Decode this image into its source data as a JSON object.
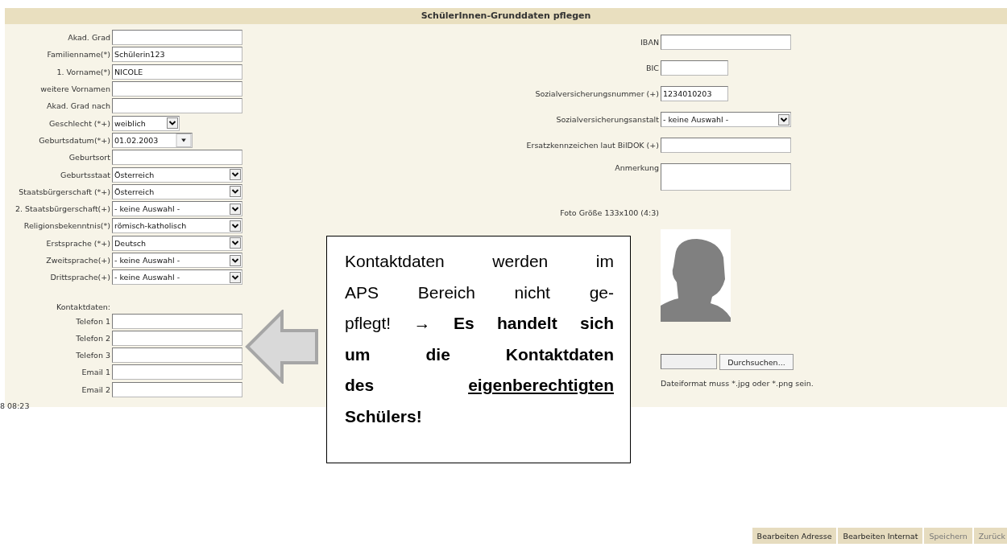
{
  "title": "SchülerInnen-Grunddaten pflegen",
  "person_fields": [
    {
      "label": "Akad. Grad",
      "kind": "text"
    },
    {
      "label": "Familienname(*)",
      "kind": "text",
      "value": "Schülerin123"
    },
    {
      "label": "1. Vorname(*)",
      "kind": "text",
      "value": "NICOLE"
    },
    {
      "label": "weitere Vornamen",
      "kind": "text"
    },
    {
      "label": "Akad. Grad nach",
      "kind": "text"
    },
    {
      "label": "Geschlecht (*+)",
      "kind": "short-select",
      "value": "weiblich"
    },
    {
      "label": "Geburtsdatum(*+)",
      "kind": "date",
      "value": "01.02.2003"
    },
    {
      "label": "Geburtsort",
      "kind": "text"
    },
    {
      "label": "Geburtsstaat",
      "kind": "select",
      "value": "Österreich"
    },
    {
      "label": "Staatsbürgerschaft (*+)",
      "kind": "select",
      "value": "Österreich"
    },
    {
      "label": "2. Staatsbürgerschaft(+)",
      "kind": "select",
      "value": "- keine Auswahl -"
    },
    {
      "label": "Religionsbekenntnis(*)",
      "kind": "select",
      "value": "römisch-katholisch"
    },
    {
      "label": "Erstsprache (*+)",
      "kind": "select",
      "value": "Deutsch"
    },
    {
      "label": "Zweitsprache(+)",
      "kind": "select",
      "value": "- keine Auswahl -"
    },
    {
      "label": "Drittsprache(+)",
      "kind": "select",
      "value": "- keine Auswahl -"
    }
  ],
  "contact_heading": "Kontaktdaten:",
  "contact_fields": [
    {
      "label": "Telefon 1",
      "kind": "text"
    },
    {
      "label": "Telefon 2",
      "kind": "text"
    },
    {
      "label": "Telefon 3",
      "kind": "text"
    },
    {
      "label": "Email 1",
      "kind": "text"
    },
    {
      "label": "Email 2",
      "kind": "text"
    }
  ],
  "timestamp": "8 08:23",
  "right_fields": [
    {
      "label": "IBAN",
      "kind": "text"
    },
    {
      "label": "BIC",
      "kind": "short-text"
    },
    {
      "label": "Sozialversicherungsnummer (+)",
      "kind": "short-text",
      "value": "1234010203"
    },
    {
      "label": "Sozialversicherungsanstalt",
      "kind": "select",
      "value": "- keine Auswahl -"
    },
    {
      "label": "Ersatzkennzeichen laut BilDOK (+)",
      "kind": "text"
    },
    {
      "label": "Anmerkung",
      "kind": "textarea"
    },
    {
      "label": "Foto Größe 133x100 (4:3)",
      "kind": "note"
    }
  ],
  "upload_button": "Durchsuchen...",
  "upload_hint": "Dateiformat muss *.jpg oder *.png sein.",
  "callout": [
    {
      "text": "Kontaktdaten werden im\nAPS Bereich nicht ge-\npflegt! → ",
      "kind": "plain"
    },
    {
      "text": "Es handelt sich\num die Kontaktdaten\ndes ",
      "kind": "emphasis"
    },
    {
      "text": "eigenberechtigten",
      "kind": "key-term"
    },
    {
      "text": "\nSchülers!",
      "kind": "emphasis"
    }
  ],
  "buttons": [
    {
      "label": "Bearbeiten Adresse",
      "disabled": false
    },
    {
      "label": "Bearbeiten Internat",
      "disabled": false
    },
    {
      "label": "Speichern",
      "disabled": true
    },
    {
      "label": "Zurück",
      "disabled": true
    }
  ]
}
